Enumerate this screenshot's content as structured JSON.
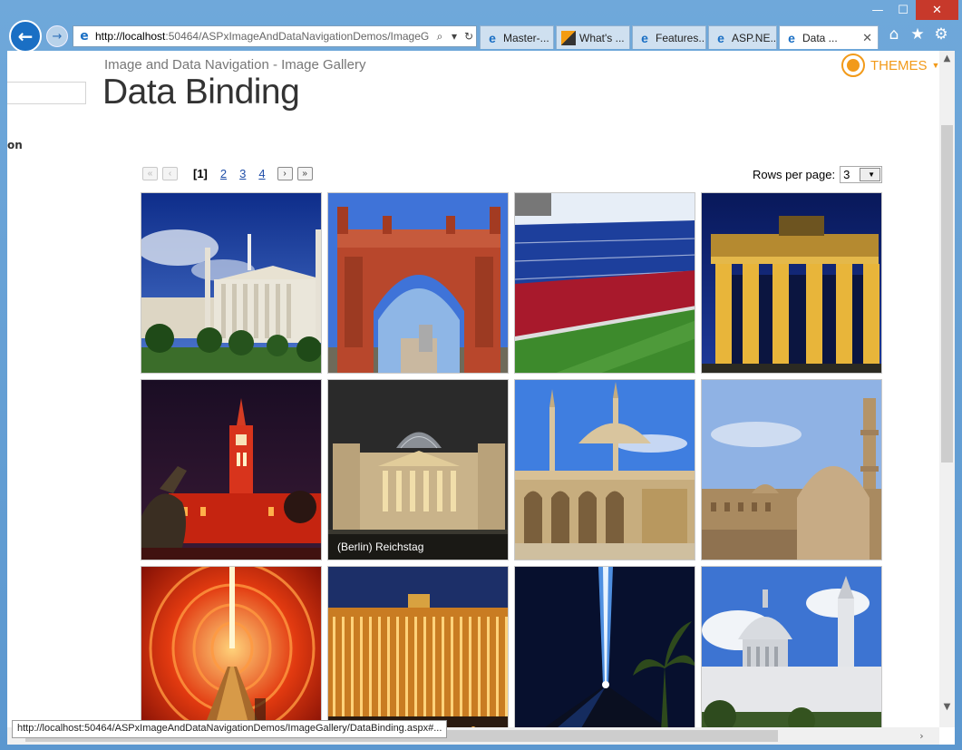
{
  "browser": {
    "address_url": "http://localhost:50464/ASPxImageAndDataNavigationDemos/ImageG",
    "url_host_part": "http://localhost",
    "url_rest": ":50464/ASPxImageAndDataNavigationDemos/ImageG",
    "tabs": [
      {
        "label": "Master-..."
      },
      {
        "label": "What's ..."
      },
      {
        "label": "Features..."
      },
      {
        "label": "ASP.NE..."
      },
      {
        "label": "Data ..."
      }
    ],
    "status_url": "http://localhost:50464/ASPxImageAndDataNavigationDemos/ImageGallery/DataBinding.aspx#..."
  },
  "page": {
    "breadcrumb": "Image and Data Navigation - Image Gallery",
    "title": "Data Binding",
    "themes_label": "THEMES",
    "side_label": "on"
  },
  "pager": {
    "current": "[1]",
    "pages": [
      "2",
      "3",
      "4"
    ],
    "rows_per_page_label": "Rows per page:",
    "rows_per_page_value": "3"
  },
  "gallery": {
    "items": [
      {
        "scene": "athens-academy"
      },
      {
        "scene": "arc-de-triomf"
      },
      {
        "scene": "stadium"
      },
      {
        "scene": "brandenburg-gate"
      },
      {
        "scene": "red-town-hall"
      },
      {
        "scene": "reichstag",
        "caption": "(Berlin) Reichstag"
      },
      {
        "scene": "mosque"
      },
      {
        "scene": "cairo-domes"
      },
      {
        "scene": "red-tunnel"
      },
      {
        "scene": "bellagio"
      },
      {
        "scene": "luxor-beam"
      },
      {
        "scene": "st-pauls"
      }
    ]
  }
}
